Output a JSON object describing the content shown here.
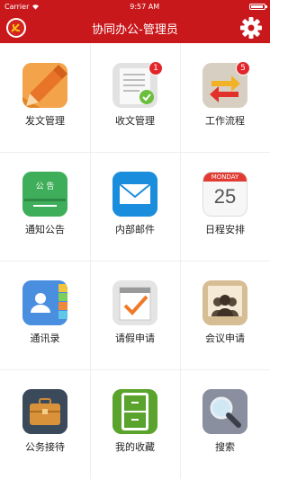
{
  "status_bar": {
    "carrier": "Carrier",
    "time": "9:57 AM"
  },
  "nav": {
    "title": "协同办公-管理员"
  },
  "calendar": {
    "weekday": "MONDAY",
    "day": "25"
  },
  "notice_board_text": "公 告",
  "items": [
    {
      "label": "发文管理",
      "icon": "pencil-document-icon"
    },
    {
      "label": "收文管理",
      "icon": "received-document-icon",
      "badge": "1"
    },
    {
      "label": "工作流程",
      "icon": "workflow-arrows-icon",
      "badge": "5"
    },
    {
      "label": "通知公告",
      "icon": "notice-board-icon"
    },
    {
      "label": "内部邮件",
      "icon": "mail-envelope-icon"
    },
    {
      "label": "日程安排",
      "icon": "calendar-icon"
    },
    {
      "label": "通讯录",
      "icon": "contacts-book-icon"
    },
    {
      "label": "请假申请",
      "icon": "leave-request-icon"
    },
    {
      "label": "会议申请",
      "icon": "meeting-icon"
    },
    {
      "label": "公务接待",
      "icon": "briefcase-icon"
    },
    {
      "label": "我的收藏",
      "icon": "favorites-cabinet-icon"
    },
    {
      "label": "搜索",
      "icon": "search-magnifier-icon"
    }
  ],
  "colors": {
    "brand_red": "#c9181c",
    "badge_red": "#e2262a",
    "label_text": "#222222"
  }
}
